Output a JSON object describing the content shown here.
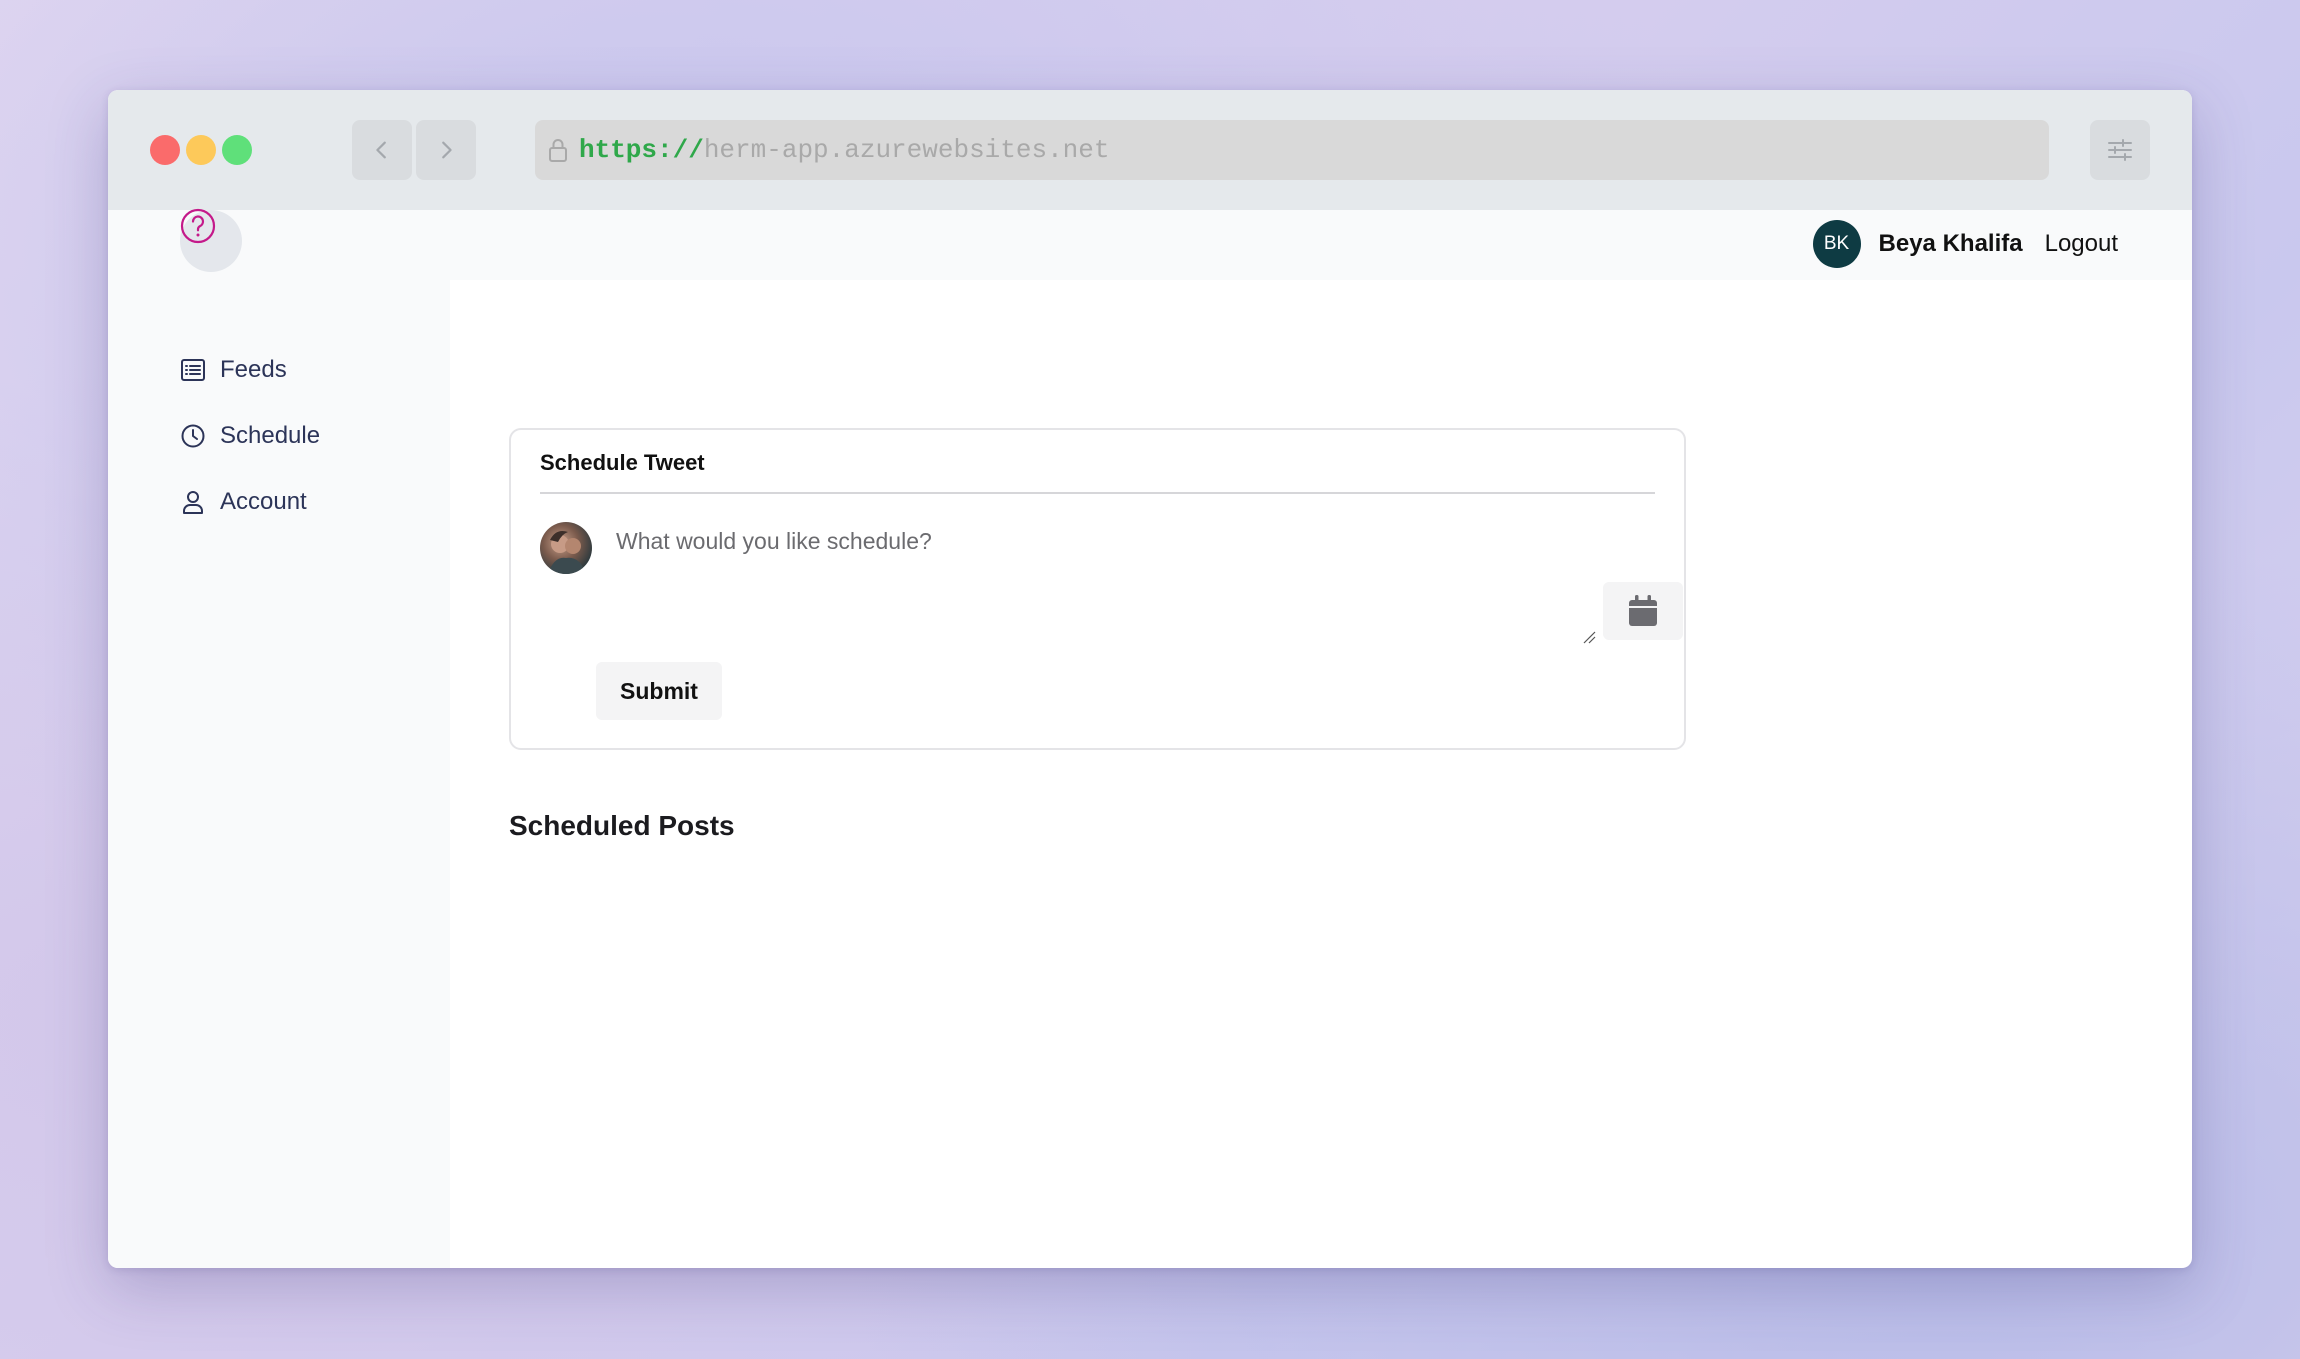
{
  "browser": {
    "url_scheme": "https://",
    "url_host": "herm-app.azurewebsites.net"
  },
  "sidebar": {
    "items": [
      {
        "label": "Feeds",
        "icon": "list-icon"
      },
      {
        "label": "Schedule",
        "icon": "clock-icon"
      },
      {
        "label": "Account",
        "icon": "user-icon"
      }
    ]
  },
  "header": {
    "user_initials": "BK",
    "user_name": "Beya Khalifa",
    "logout_label": "Logout"
  },
  "compose": {
    "title": "Schedule Tweet",
    "placeholder": "What would you like schedule?",
    "submit_label": "Submit"
  },
  "scheduled": {
    "title": "Scheduled Posts"
  },
  "colors": {
    "avatar_bg": "#0e3b43",
    "logo": "#c4198a",
    "url_scheme": "#2fa84a"
  }
}
